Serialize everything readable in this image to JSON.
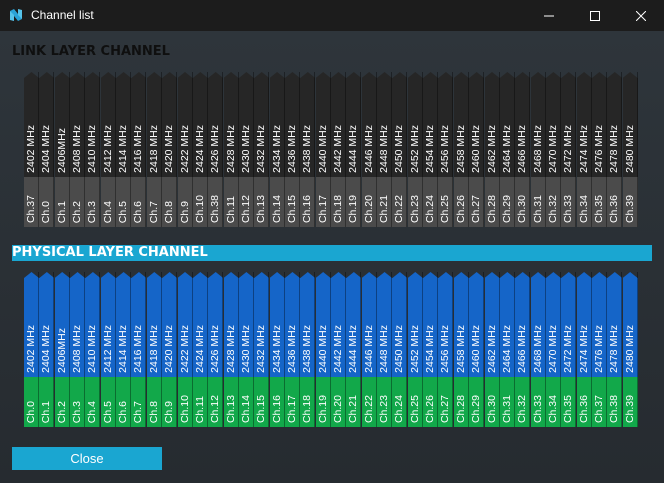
{
  "window": {
    "title": "Channel list",
    "accent": "#1aa6d1"
  },
  "link_layer": {
    "header": "LINK LAYER CHANNEL",
    "colors": {
      "freq_bg": "#262626",
      "ch_bg": "#4b4b4b"
    },
    "channels": [
      {
        "freq": "2402 MHz",
        "ch": "Ch.37"
      },
      {
        "freq": "2404 MHz",
        "ch": "Ch.0"
      },
      {
        "freq": "2406MHz",
        "ch": "Ch.1"
      },
      {
        "freq": "2408 MHz",
        "ch": "Ch.2"
      },
      {
        "freq": "2410 MHz",
        "ch": "Ch.3"
      },
      {
        "freq": "2412 MHz",
        "ch": "Ch.4"
      },
      {
        "freq": "2414 MHz",
        "ch": "Ch.5"
      },
      {
        "freq": "2416 MHz",
        "ch": "Ch.6"
      },
      {
        "freq": "2418 MHz",
        "ch": "Ch.7"
      },
      {
        "freq": "2420 MHz",
        "ch": "Ch.8"
      },
      {
        "freq": "2422 MHz",
        "ch": "Ch.9"
      },
      {
        "freq": "2424 MHz",
        "ch": "Ch.10"
      },
      {
        "freq": "2426 MHz",
        "ch": "Ch.38"
      },
      {
        "freq": "2428 MHz",
        "ch": "Ch.11"
      },
      {
        "freq": "2430 MHz",
        "ch": "Ch.12"
      },
      {
        "freq": "2432 MHz",
        "ch": "Ch.13"
      },
      {
        "freq": "2434 MHz",
        "ch": "Ch.14"
      },
      {
        "freq": "2436 MHz",
        "ch": "Ch.15"
      },
      {
        "freq": "2438 MHz",
        "ch": "Ch.16"
      },
      {
        "freq": "2440 MHz",
        "ch": "Ch.17"
      },
      {
        "freq": "2442 MHz",
        "ch": "Ch.18"
      },
      {
        "freq": "2444 MHz",
        "ch": "Ch.19"
      },
      {
        "freq": "2446 MHz",
        "ch": "Ch.20"
      },
      {
        "freq": "2448 MHz",
        "ch": "Ch.21"
      },
      {
        "freq": "2450 MHz",
        "ch": "Ch.22"
      },
      {
        "freq": "2452 MHz",
        "ch": "Ch.23"
      },
      {
        "freq": "2454 MHz",
        "ch": "Ch.24"
      },
      {
        "freq": "2456 MHz",
        "ch": "Ch.25"
      },
      {
        "freq": "2458 MHz",
        "ch": "Ch.26"
      },
      {
        "freq": "2460 MHz",
        "ch": "Ch.27"
      },
      {
        "freq": "2462 MHz",
        "ch": "Ch.28"
      },
      {
        "freq": "2464 MHz",
        "ch": "Ch.29"
      },
      {
        "freq": "2466 MHz",
        "ch": "Ch.30"
      },
      {
        "freq": "2468 MHz",
        "ch": "Ch.31"
      },
      {
        "freq": "2470 MHz",
        "ch": "Ch.32"
      },
      {
        "freq": "2472 MHz",
        "ch": "Ch.33"
      },
      {
        "freq": "2474 MHz",
        "ch": "Ch.34"
      },
      {
        "freq": "2476 MHz",
        "ch": "Ch.35"
      },
      {
        "freq": "2478 MHz",
        "ch": "Ch.36"
      },
      {
        "freq": "2480 MHz",
        "ch": "Ch.39"
      }
    ]
  },
  "physical_layer": {
    "header": "PHYSICAL LAYER CHANNEL",
    "colors": {
      "freq_bg": "#1565c8",
      "ch_bg": "#12a84a"
    },
    "channels": [
      {
        "freq": "2402 MHz",
        "ch": "Ch.0"
      },
      {
        "freq": "2404 MHz",
        "ch": "Ch.1"
      },
      {
        "freq": "2406MHz",
        "ch": "Ch.2"
      },
      {
        "freq": "2408 MHz",
        "ch": "Ch.3"
      },
      {
        "freq": "2410 MHz",
        "ch": "Ch.4"
      },
      {
        "freq": "2412 MHz",
        "ch": "Ch.5"
      },
      {
        "freq": "2414 MHz",
        "ch": "Ch.6"
      },
      {
        "freq": "2416 MHz",
        "ch": "Ch.7"
      },
      {
        "freq": "2418 MHz",
        "ch": "Ch.8"
      },
      {
        "freq": "2420 MHz",
        "ch": "Ch.9"
      },
      {
        "freq": "2422 MHz",
        "ch": "Ch.10"
      },
      {
        "freq": "2424 MHz",
        "ch": "Ch.11"
      },
      {
        "freq": "2426 MHz",
        "ch": "Ch.12"
      },
      {
        "freq": "2428 MHz",
        "ch": "Ch.13"
      },
      {
        "freq": "2430 MHz",
        "ch": "Ch.14"
      },
      {
        "freq": "2432 MHz",
        "ch": "Ch.15"
      },
      {
        "freq": "2434 MHz",
        "ch": "Ch.16"
      },
      {
        "freq": "2436 MHz",
        "ch": "Ch.17"
      },
      {
        "freq": "2438 MHz",
        "ch": "Ch.18"
      },
      {
        "freq": "2440 MHz",
        "ch": "Ch.19"
      },
      {
        "freq": "2442 MHz",
        "ch": "Ch.20"
      },
      {
        "freq": "2444 MHz",
        "ch": "Ch.21"
      },
      {
        "freq": "2446 MHz",
        "ch": "Ch.22"
      },
      {
        "freq": "2448 MHz",
        "ch": "Ch.23"
      },
      {
        "freq": "2450 MHz",
        "ch": "Ch.24"
      },
      {
        "freq": "2452 MHz",
        "ch": "Ch.25"
      },
      {
        "freq": "2454 MHz",
        "ch": "Ch.26"
      },
      {
        "freq": "2456 MHz",
        "ch": "Ch.27"
      },
      {
        "freq": "2458 MHz",
        "ch": "Ch.28"
      },
      {
        "freq": "2460 MHz",
        "ch": "Ch.29"
      },
      {
        "freq": "2462 MHz",
        "ch": "Ch.30"
      },
      {
        "freq": "2464 MHz",
        "ch": "Ch.31"
      },
      {
        "freq": "2466 MHz",
        "ch": "Ch.32"
      },
      {
        "freq": "2468 MHz",
        "ch": "Ch.33"
      },
      {
        "freq": "2470 MHz",
        "ch": "Ch.34"
      },
      {
        "freq": "2472 MHz",
        "ch": "Ch.35"
      },
      {
        "freq": "2474 MHz",
        "ch": "Ch.36"
      },
      {
        "freq": "2476 MHz",
        "ch": "Ch.37"
      },
      {
        "freq": "2478 MHz",
        "ch": "Ch.38"
      },
      {
        "freq": "2480 MHz",
        "ch": "Ch.39"
      }
    ]
  },
  "footer": {
    "close_label": "Close"
  },
  "icons": {
    "app": "app-logo-icon",
    "minimize": "minimize-icon",
    "maximize": "maximize-icon",
    "close": "close-icon"
  }
}
